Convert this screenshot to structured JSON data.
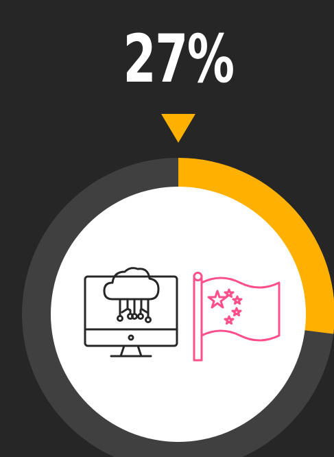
{
  "chart_data": {
    "type": "pie",
    "value_label": "27%",
    "values": [
      27,
      73
    ],
    "colors": {
      "filled": "#FFB000",
      "remaining": "#404040",
      "inner": "#FFFFFF",
      "background": "#262626",
      "pointer": "#FFB000",
      "icon_stroke": "#262626",
      "flag_stroke": "#FF4F8B"
    },
    "icons": [
      "cloud-computing-monitor-icon",
      "china-flag-icon"
    ]
  }
}
